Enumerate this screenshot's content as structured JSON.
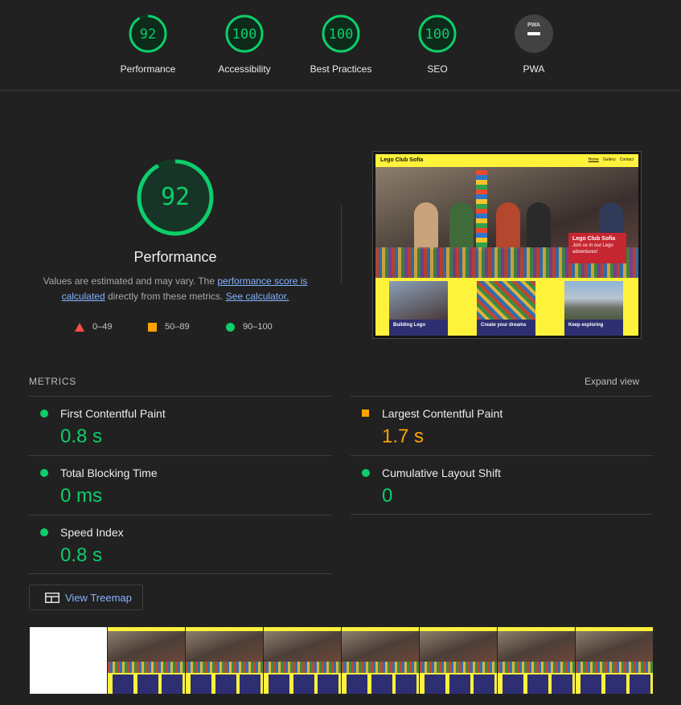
{
  "summary": {
    "gauges": [
      {
        "label": "Performance",
        "score": "92"
      },
      {
        "label": "Accessibility",
        "score": "100"
      },
      {
        "label": "Best Practices",
        "score": "100"
      },
      {
        "label": "SEO",
        "score": "100"
      },
      {
        "label": "PWA",
        "score": "PWA"
      }
    ]
  },
  "performance": {
    "score": "92",
    "score_fraction": 0.92,
    "title": "Performance",
    "desc_prefix": "Values are estimated and may vary. The ",
    "score_link": "performance score is calculated",
    "desc_mid": " directly from these metrics. ",
    "calc_link": "See calculator.",
    "legend": [
      {
        "shape": "triangle",
        "range": "0–49",
        "color": "#ff4e42"
      },
      {
        "shape": "square",
        "range": "50–89",
        "color": "#ffa400"
      },
      {
        "shape": "circle",
        "range": "90–100",
        "color": "#0cce6b"
      }
    ]
  },
  "screenshot": {
    "site_title": "Lego Club Sofia",
    "nav": [
      "Home",
      "Gallery",
      "Contact"
    ],
    "hero_title": "Lego Club Sofia",
    "hero_sub": "Join us in our Lego adventures!",
    "cards": [
      "Building Lego",
      "Create your dreams",
      "Keep exploring"
    ]
  },
  "metrics": {
    "heading": "METRICS",
    "expand": "Expand view",
    "items": [
      {
        "name": "First Contentful Paint",
        "value": "0.8 s",
        "rating": "good"
      },
      {
        "name": "Largest Contentful Paint",
        "value": "1.7 s",
        "rating": "average"
      },
      {
        "name": "Total Blocking Time",
        "value": "0 ms",
        "rating": "good"
      },
      {
        "name": "Cumulative Layout Shift",
        "value": "0",
        "rating": "good"
      },
      {
        "name": "Speed Index",
        "value": "0.8 s",
        "rating": "good"
      }
    ]
  },
  "treemap": {
    "label": "View Treemap"
  },
  "colors": {
    "good": "#0cce6b",
    "average": "#ffa400",
    "fail": "#ff4e42",
    "link": "#84b4ff",
    "background": "#212121"
  }
}
